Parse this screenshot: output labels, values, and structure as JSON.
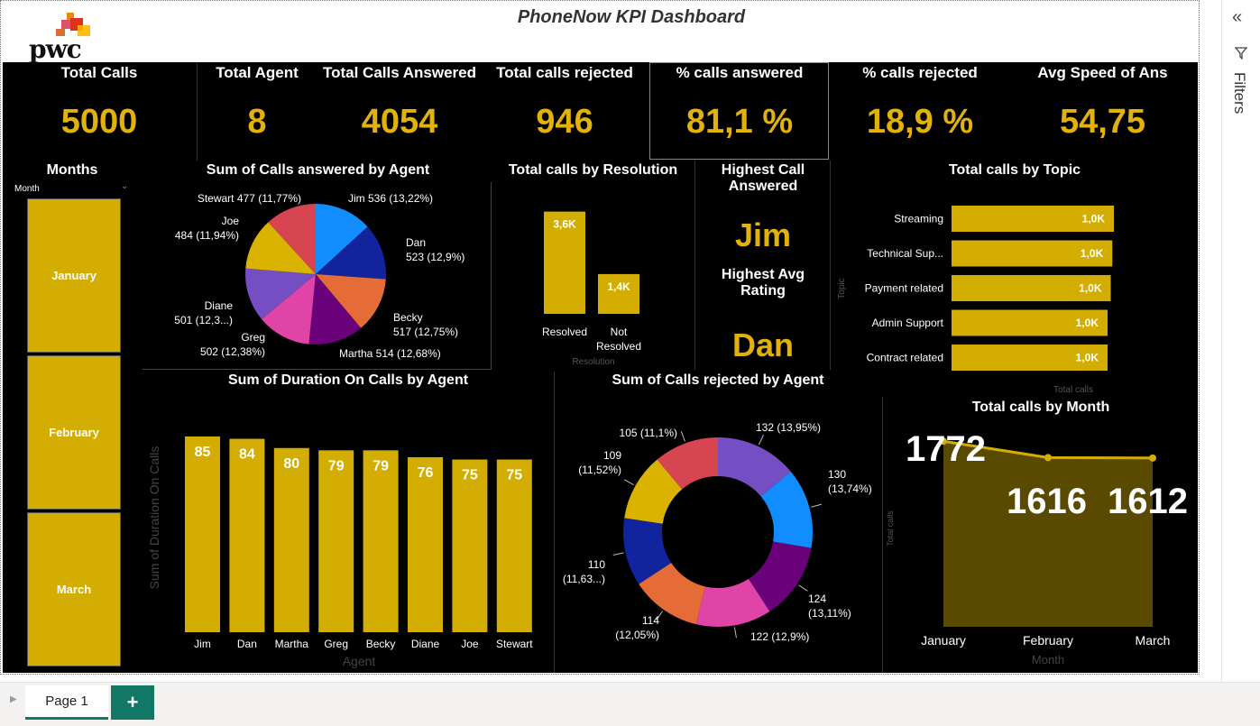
{
  "title": "PhoneNow KPI Dashboard",
  "logo": "pwc",
  "kpis": [
    {
      "label": "Total Calls",
      "value": "5000"
    },
    {
      "label": "Total Agent",
      "value": "8"
    },
    {
      "label": "Total Calls Answered",
      "value": "4054"
    },
    {
      "label": "Total calls rejected",
      "value": "946"
    },
    {
      "label": "% calls answered",
      "value": "81,1 %"
    },
    {
      "label": "% calls rejected",
      "value": "18,9 %"
    },
    {
      "label": "Avg Speed of Ans",
      "value": "54,75"
    }
  ],
  "months": {
    "title": "Months",
    "field": "Month",
    "items": [
      "January",
      "February",
      "March"
    ]
  },
  "highest": {
    "answered_label": "Highest Call Answered",
    "answered_value": "Jim",
    "rating_label": "Highest Avg Rating",
    "rating_value": "Dan"
  },
  "pane": {
    "filters": "Filters"
  },
  "tabs": {
    "page": "Page 1",
    "add": "+"
  },
  "colors": {
    "accent": "#d4ad02",
    "value": "#e3b20a",
    "background": "#000000",
    "tab": "#117865"
  },
  "chart_data": [
    {
      "type": "pie",
      "title": "Sum of Calls answered by Agent",
      "slices": [
        {
          "name": "Jim",
          "value": 536,
          "label": "Jim 536 (13,22%)",
          "color": "#118dff"
        },
        {
          "name": "Dan",
          "value": 523,
          "label": "Dan 523 (12,9%)",
          "color": "#12239e"
        },
        {
          "name": "Becky",
          "value": 517,
          "label": "Becky 517 (12,75%)",
          "color": "#e66c37"
        },
        {
          "name": "Martha",
          "value": 514,
          "label": "Martha 514 (12,68%)",
          "color": "#6b007b"
        },
        {
          "name": "Greg",
          "value": 502,
          "label": "Greg 502 (12,38%)",
          "color": "#e044a7"
        },
        {
          "name": "Diane",
          "value": 501,
          "label": "Diane 501 (12,3...)",
          "color": "#744ec2"
        },
        {
          "name": "Joe",
          "value": 484,
          "label": "Joe 484 (11,94%)",
          "color": "#d9b300"
        },
        {
          "name": "Stewart",
          "value": 477,
          "label": "Stewart 477 (11,77%)",
          "color": "#d64550"
        }
      ]
    },
    {
      "type": "bar",
      "title": "Total calls by Resolution",
      "categories": [
        "Resolved",
        "Not Resolved"
      ],
      "values": [
        3600,
        1400
      ],
      "value_labels": [
        "3,6K",
        "1,4K"
      ],
      "xlabel": "Resolution"
    },
    {
      "type": "bar",
      "orientation": "horizontal",
      "title": "Total calls by Topic",
      "categories": [
        "Streaming",
        "Technical Sup...",
        "Payment related",
        "Admin Support",
        "Contract related"
      ],
      "values": [
        1030,
        1020,
        1010,
        990,
        990
      ],
      "value_labels": [
        "1,0K",
        "1,0K",
        "1,0K",
        "1,0K",
        "1,0K"
      ],
      "xlabel": "Total calls",
      "ylabel": "Topic"
    },
    {
      "type": "bar",
      "title": "Sum of Duration On Calls by Agent",
      "categories": [
        "Jim",
        "Dan",
        "Martha",
        "Greg",
        "Becky",
        "Diane",
        "Joe",
        "Stewart"
      ],
      "values": [
        85,
        84,
        80,
        79,
        79,
        76,
        75,
        75
      ],
      "xlabel": "Agent",
      "ylabel": "Sum of Duration On Calls"
    },
    {
      "type": "pie",
      "donut": true,
      "title": "Sum of Calls rejected by Agent",
      "slices": [
        {
          "value": 132,
          "label": "132 (13,95%)",
          "color": "#744ec2"
        },
        {
          "value": 130,
          "label": "130 (13,74%)",
          "color": "#118dff"
        },
        {
          "value": 124,
          "label": "124 (13,11%)",
          "color": "#6b007b"
        },
        {
          "value": 122,
          "label": "122 (12,9%)",
          "color": "#e044a7"
        },
        {
          "value": 114,
          "label": "114 (12,05%)",
          "color": "#e66c37"
        },
        {
          "value": 110,
          "label": "110 (11,63...)",
          "color": "#12239e"
        },
        {
          "value": 109,
          "label": "109 (11,52%)",
          "color": "#d9b300"
        },
        {
          "value": 105,
          "label": "105 (11,1%)",
          "color": "#d64550"
        }
      ]
    },
    {
      "type": "area",
      "title": "Total calls by Month",
      "categories": [
        "January",
        "February",
        "March"
      ],
      "values": [
        1772,
        1616,
        1612
      ],
      "xlabel": "Month",
      "ylabel": "Total calls"
    }
  ]
}
